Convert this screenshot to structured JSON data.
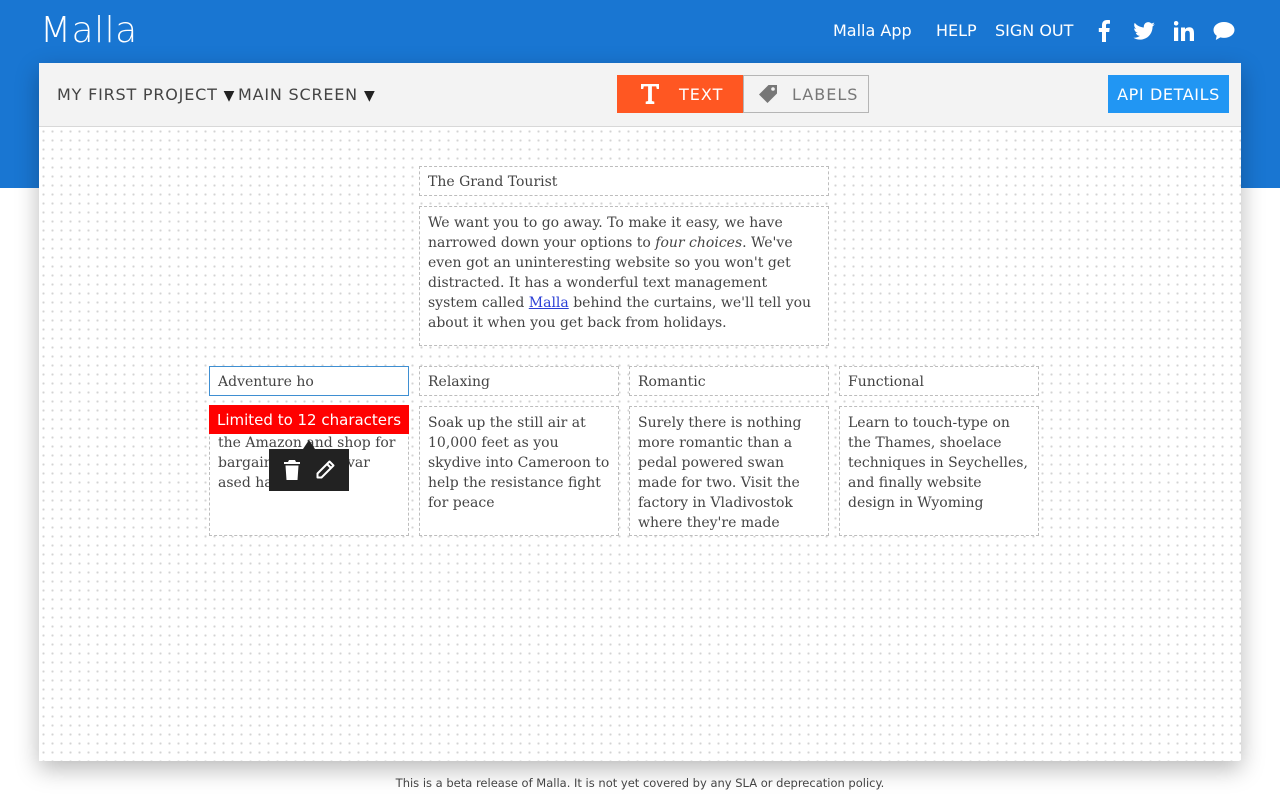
{
  "app": {
    "brand": "Malla",
    "nav": {
      "app_link": "Malla App",
      "help": "HELP",
      "signout": "SIGN OUT"
    },
    "social_icons": [
      "facebook-icon",
      "twitter-icon",
      "linkedin-icon",
      "chat-icon"
    ]
  },
  "toolbar": {
    "project": "MY FIRST PROJECT",
    "screen": "MAIN SCREEN",
    "dropdown_glyph": "▼",
    "mode_text": "TEXT",
    "mode_labels": "LABELS",
    "api_button": "API DETAILS"
  },
  "content": {
    "title": "The Grand Tourist",
    "intro": {
      "part1": "We want you to go away. To make it easy, we have narrowed down your options to ",
      "emphasis": "four choices",
      "part2": ". We've even got an uninteresting website so you won't get distracted. It has a wonderful text management system called ",
      "link": "Malla",
      "part3": " behind the curtains, we'll tell you about it when you get back from holidays."
    },
    "cards": [
      {
        "title": "Adventure ho",
        "body": "the Amazon and shop for bargain        belts and var         ased handy tools"
      },
      {
        "title": "Relaxing",
        "body": "Soak up the still air at 10,000 feet as you skydive into Cameroon to help the resistance fight for peace"
      },
      {
        "title": "Romantic",
        "body": "Surely there is nothing more romantic than a pedal powered swan made for two. Visit the factory in Vladivostok where they're made"
      },
      {
        "title": "Functional",
        "body": "Learn to touch-type on the Thames, shoelace techniques in Seychelles, and finally website design in Wyoming"
      }
    ]
  },
  "validation": {
    "message": "Limited to 12 characters"
  },
  "context_menu": {
    "icons": [
      "trash-icon",
      "pencil-icon"
    ]
  },
  "footer": {
    "text": "This is a beta release of Malla. It is not yet covered by any SLA or deprecation policy."
  },
  "colors": {
    "header": "#1976d2",
    "mode_active": "#ff5722",
    "api_button": "#2196f3",
    "error": "#ff0000",
    "selected_border": "#3f8fd2",
    "link": "#2b3fd6"
  }
}
